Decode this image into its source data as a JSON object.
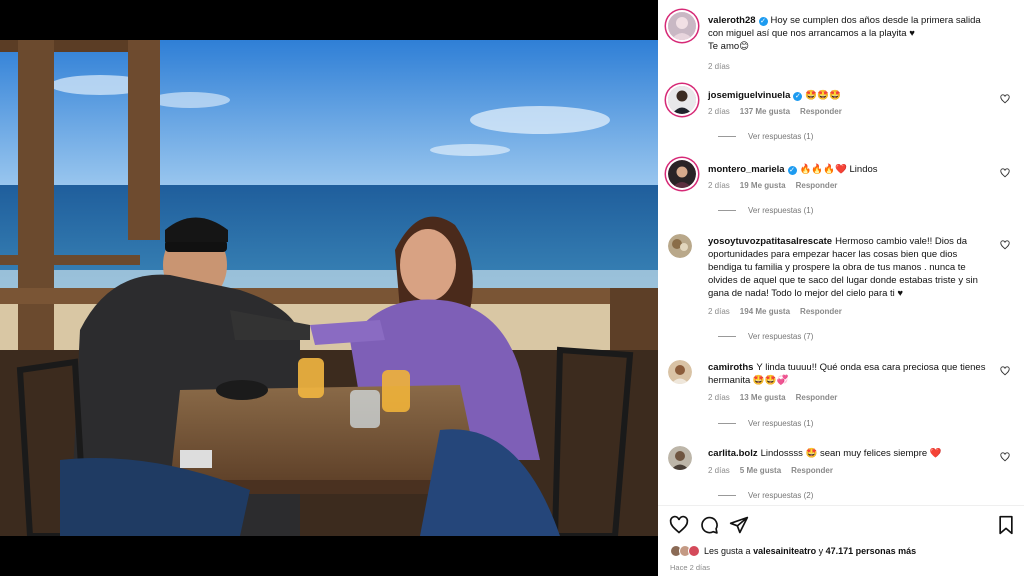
{
  "post": {
    "author": "valeroth28",
    "caption_line1": "Hoy se cumplen dos años desde la primera salida con miguel así que nos arrancamos a la playita ♥",
    "caption_line2": "Te amo😊",
    "time": "2 días",
    "photo_description_icon": "photo-couple-at-beach-restaurant"
  },
  "comments": [
    {
      "user": "josemiguelvinuela",
      "verified": true,
      "text": "🤩🤩🤩",
      "time": "2 días",
      "likes": "137 Me gusta",
      "reply": "Responder",
      "replies": "Ver respuestas (1)"
    },
    {
      "user": "montero_mariela",
      "verified": true,
      "text": "🔥🔥🔥❤️ Lindos",
      "time": "2 días",
      "likes": "19 Me gusta",
      "reply": "Responder",
      "replies": "Ver respuestas (1)"
    },
    {
      "user": "yosoytuvozpatitasalrescate",
      "verified": false,
      "text": "Hermoso cambio vale!! Dios da oportunidades para empezar hacer las cosas bien que dios bendiga tu familia y prospere la obra de tus manos . nunca te olvides de aquel que te saco del lugar donde estabas triste y sin gana de nada! Todo lo mejor del cielo para ti ♥",
      "time": "2 días",
      "likes": "194 Me gusta",
      "reply": "Responder",
      "replies": "Ver respuestas (7)"
    },
    {
      "user": "camiroths",
      "verified": false,
      "text": "Y linda tuuuu!! Qué onda esa cara preciosa que tienes hermanita 🤩🤩💞",
      "time": "2 días",
      "likes": "13 Me gusta",
      "reply": "Responder",
      "replies": "Ver respuestas (1)"
    },
    {
      "user": "carlita.bolz",
      "verified": false,
      "text": "Lindossss 🤩 sean muy felices siempre ❤️",
      "time": "2 días",
      "likes": "5 Me gusta",
      "reply": "Responder",
      "replies": "Ver respuestas (2)"
    }
  ],
  "likes_summary": {
    "prefix": "Les gusta a",
    "user": "valesainiteatro",
    "middle": "y",
    "count": "47.171 personas más"
  },
  "posted_when": "Hace 2 días",
  "colors": {
    "accent_ring": "#d62976",
    "verified": "#1d9bf0",
    "meta_gray": "#8a8a8a"
  }
}
